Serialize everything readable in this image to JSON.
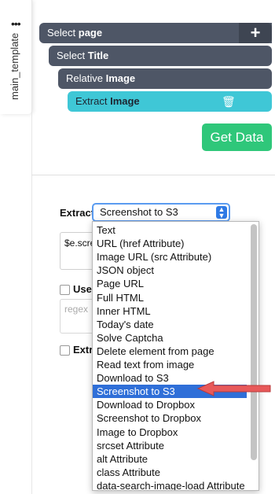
{
  "sidebar": {
    "menu_dots": "•••",
    "tab_label": "main_template"
  },
  "chain": [
    {
      "verb": "Select",
      "target": "page"
    },
    {
      "verb": "Select",
      "target": "Title"
    },
    {
      "verb": "Relative",
      "target": "Image"
    },
    {
      "verb": "Extract",
      "target": "Image"
    }
  ],
  "icons": {
    "add": "+",
    "trash": "🗑"
  },
  "get_data_label": "Get Data",
  "form": {
    "extract_label": "Extract",
    "extract_selected": "Screenshot to S3",
    "code_value": "$e.scre",
    "use_label": "Use r",
    "regex_placeholder": "regex",
    "extra_label": "Extra"
  },
  "dropdown": {
    "options": [
      "Text",
      "URL (href Attribute)",
      "Image URL (src Attribute)",
      "JSON object",
      "Page URL",
      "Full HTML",
      "Inner HTML",
      "Today's date",
      "Solve Captcha",
      "Delete element from page",
      "Read text from image",
      "Download to S3",
      "Screenshot to S3",
      "Download to Dropbox",
      "Screenshot to Dropbox",
      "Image to Dropbox",
      "srcset Attribute",
      "alt Attribute",
      "class Attribute",
      "data-search-image-load Attribute"
    ],
    "selected_index": 12
  },
  "colors": {
    "pill_dark": "#4e5666",
    "pill_active": "#3fc7d6",
    "get_data": "#2fc77a",
    "selection": "#2f6fd8",
    "arrow": "#e8595a"
  }
}
